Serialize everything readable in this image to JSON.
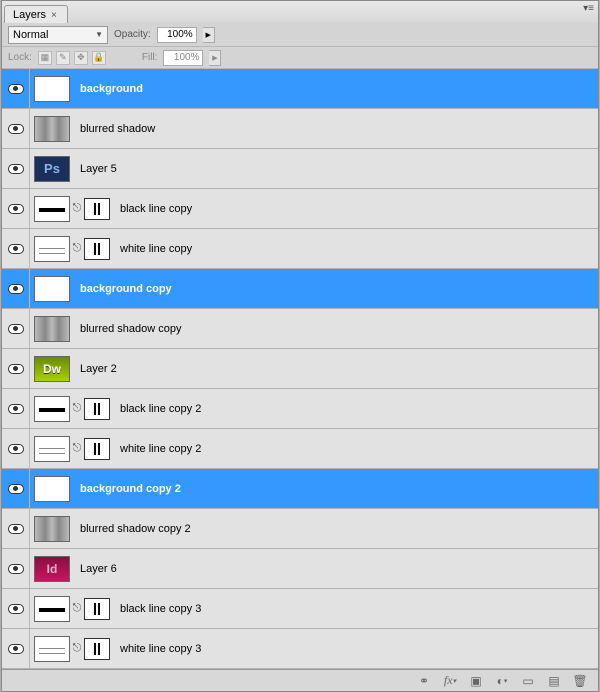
{
  "tab": {
    "title": "Layers"
  },
  "controls": {
    "blend_mode": "Normal",
    "opacity_label": "Opacity:",
    "opacity_value": "100%",
    "lock_label": "Lock:",
    "fill_label": "Fill:",
    "fill_value": "100%"
  },
  "layers": [
    {
      "name": "background",
      "selected": true,
      "thumb": "white",
      "mask": false
    },
    {
      "name": "blurred shadow",
      "selected": false,
      "thumb": "grad-grey",
      "mask": false
    },
    {
      "name": "Layer 5",
      "selected": false,
      "thumb": "ps",
      "thumb_text": "Ps",
      "mask": false
    },
    {
      "name": "black line copy",
      "selected": false,
      "thumb": "black-line",
      "mask": true
    },
    {
      "name": "white line copy",
      "selected": false,
      "thumb": "white-line",
      "mask": true
    },
    {
      "name": "background copy",
      "selected": true,
      "thumb": "white",
      "mask": false
    },
    {
      "name": "blurred shadow copy",
      "selected": false,
      "thumb": "grad-grey",
      "mask": false
    },
    {
      "name": "Layer 2",
      "selected": false,
      "thumb": "dw",
      "thumb_text": "Dw",
      "mask": false
    },
    {
      "name": "black line copy 2",
      "selected": false,
      "thumb": "black-line",
      "mask": true
    },
    {
      "name": "white line copy 2",
      "selected": false,
      "thumb": "white-line",
      "mask": true
    },
    {
      "name": "background copy 2",
      "selected": true,
      "thumb": "white",
      "mask": false
    },
    {
      "name": "blurred shadow copy 2",
      "selected": false,
      "thumb": "grad-grey",
      "mask": false
    },
    {
      "name": "Layer 6",
      "selected": false,
      "thumb": "id",
      "thumb_text": "Id",
      "mask": false
    },
    {
      "name": "black line copy 3",
      "selected": false,
      "thumb": "black-line",
      "mask": true
    },
    {
      "name": "white line copy 3",
      "selected": false,
      "thumb": "white-line",
      "mask": true
    }
  ],
  "footer_icons": [
    "link",
    "fx",
    "mask",
    "adjust",
    "group",
    "new",
    "trash"
  ]
}
